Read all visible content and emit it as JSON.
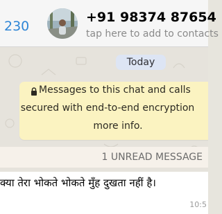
{
  "header": {
    "back_count": "230",
    "contact_name": "+91 98374 87654",
    "subtitle": "tap here to add to contacts"
  },
  "chat": {
    "date_label": "Today",
    "encryption_notice": {
      "line1": "Messages to this chat and calls",
      "line2": "secured with end-to-end encryption",
      "line3": "more info."
    },
    "unread_label": "1 UNREAD MESSAGE",
    "message": {
      "text": "क्या तेरा भोकते भोकते मुँह दुखता नहीं है।",
      "time": "10:5"
    }
  },
  "colors": {
    "accent": "#2f86d6",
    "chat_background": "#e6e3dc",
    "notice_background": "#fbf3c1",
    "date_pill": "#dde5f4"
  },
  "icons": [
    "profile-photo-avatar",
    "lock-icon"
  ]
}
